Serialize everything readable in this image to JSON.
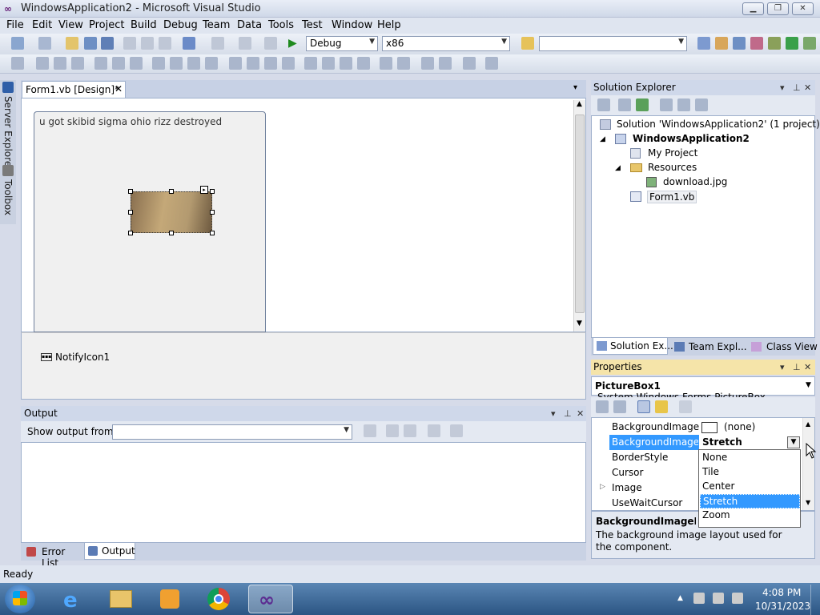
{
  "window": {
    "title": "WindowsApplication2 - Microsoft Visual Studio"
  },
  "menu": [
    "File",
    "Edit",
    "View",
    "Project",
    "Build",
    "Debug",
    "Team",
    "Data",
    "Tools",
    "Test",
    "Window",
    "Help"
  ],
  "toolbar": {
    "config": "Debug",
    "platform": "x86",
    "find": ""
  },
  "side_tabs": {
    "server_explorer": "Server Explorer",
    "toolbox": "Toolbox"
  },
  "designer": {
    "tab": "Form1.vb [Design]*",
    "form_text": "u got skibid sigma ohio rizz destroyed",
    "tray_component": "NotifyIcon1"
  },
  "output": {
    "title": "Output",
    "show_from_label": "Show output from:",
    "show_from_value": ""
  },
  "bottom_tabs": [
    "Error List",
    "Output"
  ],
  "solution_explorer": {
    "title": "Solution Explorer",
    "items": [
      "Solution 'WindowsApplication2' (1 project)",
      "WindowsApplication2",
      "My Project",
      "Resources",
      "download.jpg",
      "Form1.vb"
    ],
    "tabs": [
      "Solution Ex...",
      "Team Expl...",
      "Class View"
    ]
  },
  "properties": {
    "title": "Properties",
    "object": "PictureBox1",
    "object_type": "System.Windows.Forms.PictureBox",
    "rows": [
      {
        "name": "BackgroundImage",
        "value": "(none)"
      },
      {
        "name": "BackgroundImageLa",
        "value": "Stretch"
      },
      {
        "name": "BorderStyle",
        "value": ""
      },
      {
        "name": "Cursor",
        "value": ""
      },
      {
        "name": "Image",
        "value": ""
      },
      {
        "name": "UseWaitCursor",
        "value": ""
      }
    ],
    "desc_title": "BackgroundImageLayo",
    "desc_text": "The background image layout used for the component."
  },
  "dropdown": {
    "options": [
      "None",
      "Tile",
      "Center",
      "Stretch",
      "Zoom"
    ],
    "selected": "Stretch"
  },
  "status": "Ready",
  "clock": {
    "time": "4:08 PM",
    "date": "10/31/2023"
  }
}
